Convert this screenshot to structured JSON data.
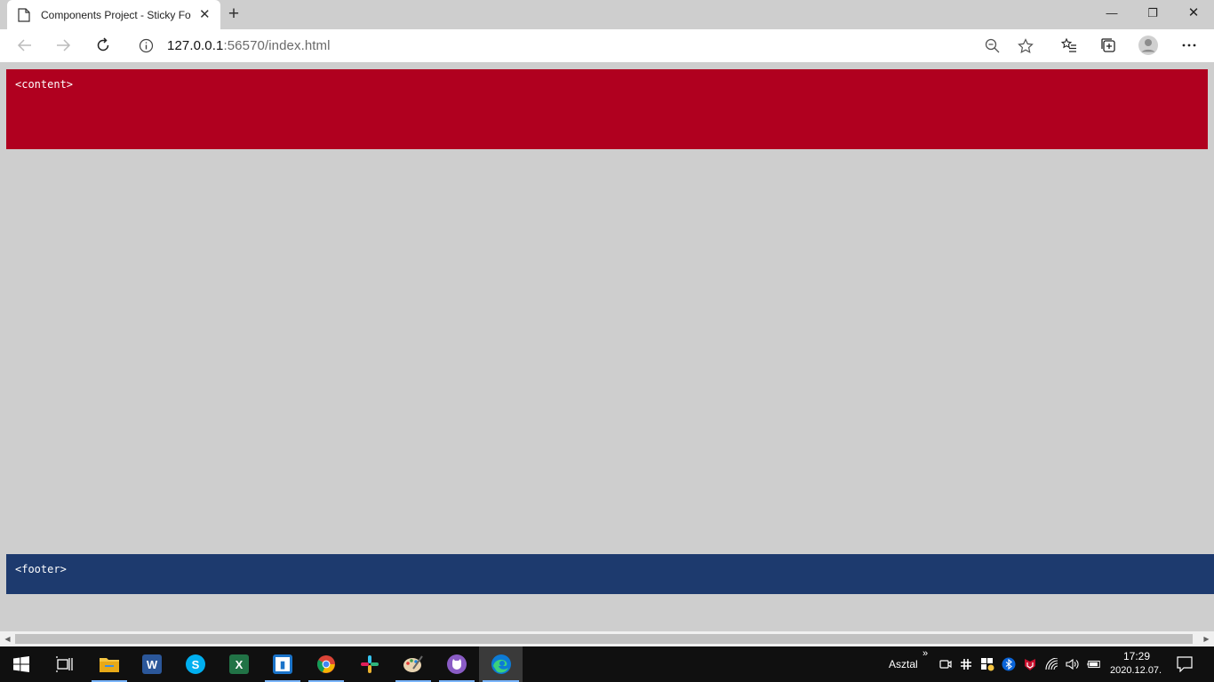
{
  "browser": {
    "tab": {
      "title": "Components Project - Sticky Footer",
      "close_glyph": "✕"
    },
    "new_tab_glyph": "+",
    "window_controls": {
      "minimize": "—",
      "restore": "❐",
      "close": "✕"
    },
    "address": {
      "host": "127.0.0.1",
      "port_path": ":56570/index.html"
    },
    "nav_icons": [
      "back-icon",
      "forward-icon",
      "refresh-icon",
      "info-icon"
    ],
    "toolbar_icons": [
      "zoom-icon",
      "favorite-star-icon",
      "favorites-list-icon",
      "collections-icon",
      "profile-avatar-icon",
      "more-menu-icon"
    ]
  },
  "page": {
    "content_label": "<content>",
    "footer_label": "<footer>",
    "colors": {
      "background": "#cecece",
      "content": "#b0001f",
      "footer": "#1d3a6e"
    }
  },
  "taskbar": {
    "apps": [
      "start-icon",
      "task-view-icon",
      "file-explorer-icon",
      "word-icon",
      "skype-icon",
      "excel-icon",
      "app-tile-icon",
      "chrome-icon",
      "slack-icon",
      "paint-icon",
      "github-desktop-icon",
      "edge-icon"
    ],
    "tray": {
      "toolbar_label": "Asztal",
      "overflow_glyph": "»",
      "time": "17:29",
      "date": "2020.12.07."
    }
  }
}
